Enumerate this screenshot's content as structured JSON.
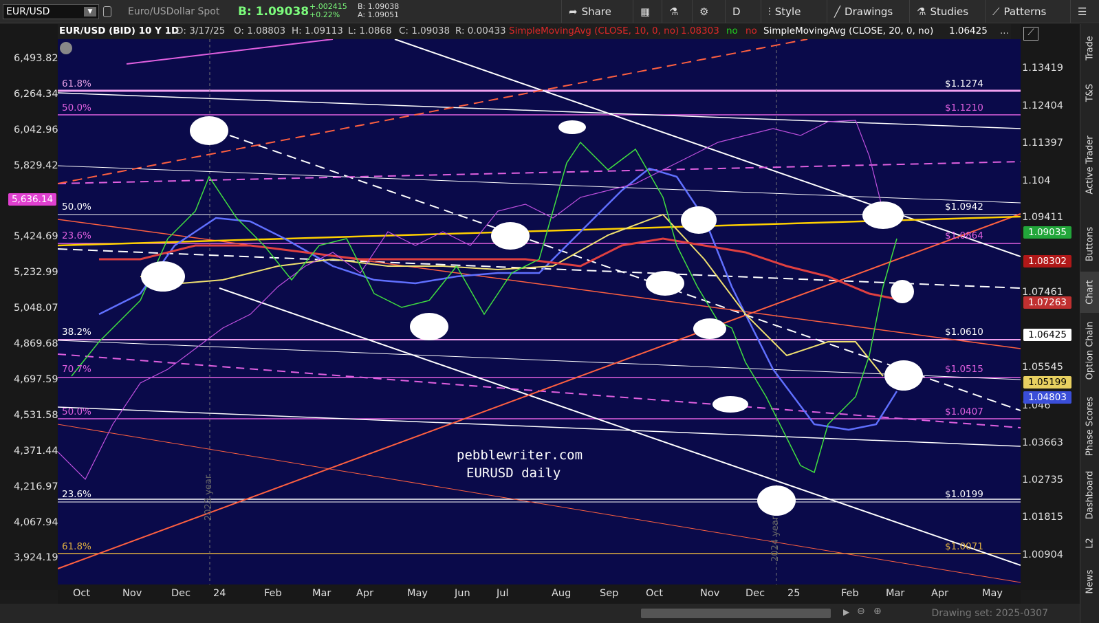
{
  "toolbar": {
    "symbol": "EUR/USD",
    "description": "Euro/USDollar Spot",
    "bid": "B: 1.09038",
    "change_abs": "+.002415",
    "change_pct": "+0.22%",
    "bid_small": "B: 1.09038",
    "ask_small": "A: 1.09051",
    "buttons": {
      "share": "Share",
      "period": "D",
      "style": "Style",
      "drawings": "Drawings",
      "studies": "Studies",
      "patterns": "Patterns"
    }
  },
  "header": {
    "title": "EUR/USD (BID) 10 Y 1D",
    "date": "D: 3/17/25",
    "open": "O: 1.08803",
    "high": "H: 1.09113",
    "low": "L: 1.0868",
    "close": "C: 1.09038",
    "range": "R: 0.00433",
    "sma10": "SimpleMovingAvg (CLOSE, 10, 0, no)",
    "sma10_val": "1.08303",
    "no1": "no",
    "no2": "no",
    "sma20": "SimpleMovingAvg (CLOSE, 20, 0, no)",
    "sma20_val": "1.06425",
    "more": "..."
  },
  "left_axis": [
    "6,493.82",
    "6,264.34",
    "6,042.96",
    "5,829.42",
    "5,424.69",
    "5,232.99",
    "5,048.07",
    "4,869.68",
    "4,697.59",
    "4,531.58",
    "4,371.44",
    "4,216.97",
    "4,067.94",
    "3,924.19"
  ],
  "left_tag": "5,636.14",
  "right_axis": [
    "1.13419",
    "1.12404",
    "1.11397",
    "1.104",
    "1.09411",
    "1.07461",
    "1.05545",
    "1.046",
    "1.03663",
    "1.02735",
    "1.01815",
    "1.00904"
  ],
  "right_tags": [
    {
      "label": "1.09035",
      "color": "#22a63a",
      "text": "#ffffff"
    },
    {
      "label": "1.08302",
      "color": "#b01818",
      "text": "#ffffff"
    },
    {
      "label": "1.07263",
      "color": "#c03030",
      "text": "#ffffff"
    },
    {
      "label": "1.06425",
      "color": "#ffffff",
      "text": "#000000"
    },
    {
      "label": "1.05199",
      "color": "#e8d060",
      "text": "#000000"
    },
    {
      "label": "1.04803",
      "color": "#3a4ed8",
      "text": "#ffffff"
    }
  ],
  "x_axis": [
    "Oct",
    "Nov",
    "Dec",
    "24",
    "Feb",
    "Mar",
    "Apr",
    "May",
    "Jun",
    "Jul",
    "Aug",
    "Sep",
    "Oct",
    "Nov",
    "Dec",
    "25",
    "Feb",
    "Mar",
    "Apr",
    "May"
  ],
  "fib_labels": [
    "61.8%",
    "50.0%",
    "50.0%",
    "23.6%",
    "38.2%",
    "70.7%",
    "50.0%",
    "23.6%",
    "61.8%"
  ],
  "price_labels": [
    "$1.1274",
    "$1.1210",
    "$1.0942",
    "$1.0864",
    "$1.0610",
    "$1.0515",
    "$1.0407",
    "$1.0199",
    "$1.0071"
  ],
  "watermark": [
    "pebblewriter.com",
    "EURUSD daily"
  ],
  "year_labels": [
    "2023 year",
    "2024 year"
  ],
  "side_tabs": [
    "Trade",
    "T&S",
    "Active Trader",
    "Buttons",
    "Chart",
    "Option Chain",
    "Phase Scores",
    "Dashboard",
    "L2",
    "News"
  ],
  "status": "Drawing set: 2025-0307",
  "colors": {
    "plot_bg": "#0a0a4a",
    "sma_yellow": "#f0c020",
    "sma_red": "#e04040",
    "sma_blue": "#6070ff",
    "fib_pink": "#e060e0"
  }
}
